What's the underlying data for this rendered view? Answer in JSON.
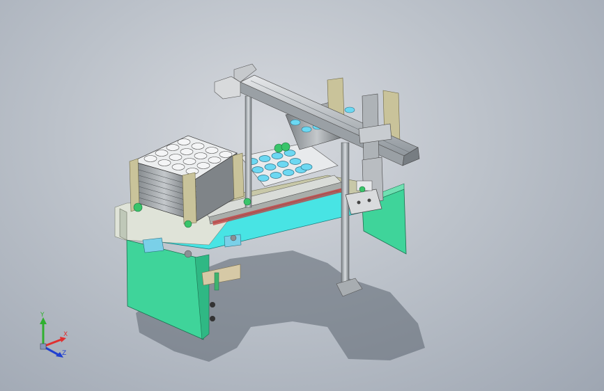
{
  "view": {
    "background_top": "#d6d9de",
    "background_bottom": "#9ea6b2"
  },
  "triad": {
    "x_label": "X",
    "y_label": "Y",
    "z_label": "Z",
    "x_color": "#e03030",
    "y_color": "#30b030",
    "z_color": "#2040d0"
  },
  "model": {
    "frame_color": "#3fd49a",
    "deck_color": "#48e4e4",
    "tray_color": "#6cd8f2",
    "rail_color": "#b8bcc0",
    "bracket_color": "#c9c39a"
  }
}
